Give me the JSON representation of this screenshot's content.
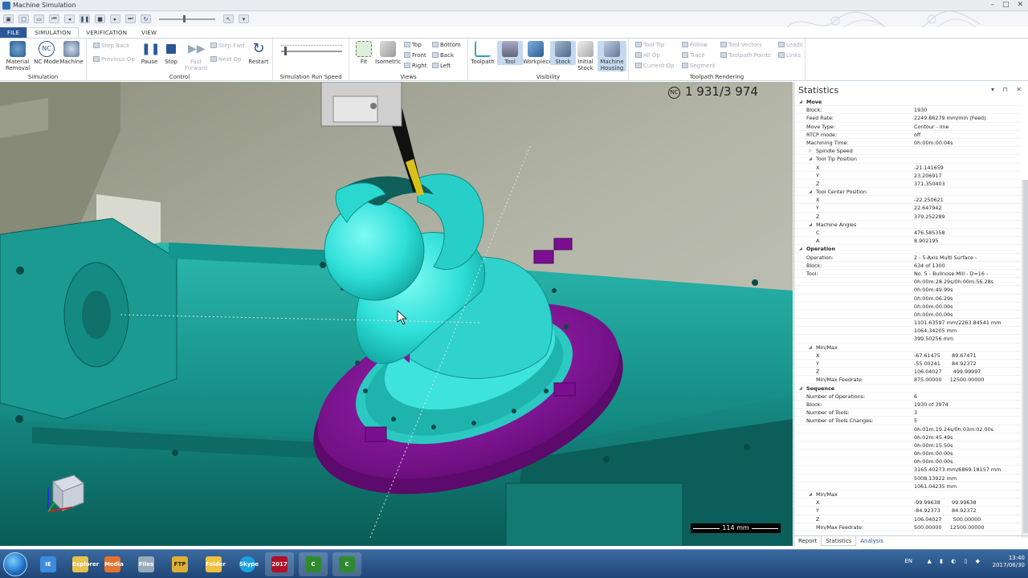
{
  "app": {
    "title": "Machine Simulation",
    "window_controls": [
      "–",
      "□",
      "✕"
    ]
  },
  "tabs": [
    "FILE",
    "SIMULATION",
    "VERIFICATION",
    "VIEW"
  ],
  "ribbon": {
    "simulation": {
      "label": "Simulation",
      "material_removal": "Material Removal",
      "nc_mode": "NC Mode",
      "machine": "Machine"
    },
    "control": {
      "label": "Control",
      "step_back": "Step Back",
      "previous_op": "Previous Op",
      "pause": "Pause",
      "stop": "Stop",
      "fast_forward": "Fast Forward",
      "step_fwd": "Step Fwd",
      "next_op": "Next Op",
      "restart": "Restart"
    },
    "run_speed": {
      "label": "Simulation Run Speed"
    },
    "views": {
      "label": "Views",
      "fit": "Fit",
      "isometric": "Isometric",
      "top": "Top",
      "front": "Front",
      "right": "Right",
      "bottom": "Bottom",
      "back": "Back",
      "left": "Left"
    },
    "visibility": {
      "label": "Visibility",
      "toolpath": "Toolpath",
      "tool": "Tool",
      "workpiece": "Workpiece",
      "stock": "Stock",
      "initial_stock": "Initial Stock",
      "machine_housing": "Machine Housing"
    },
    "toolpath_rendering": {
      "label": "Toolpath Rendering",
      "tool_tip": "Tool Tip",
      "all_op": "All Op",
      "current_op": "Current Op",
      "follow": "Follow",
      "trace": "Trace",
      "segment": "Segment",
      "tool_vectors": "Tool Vectors",
      "toolpath_points": "Toolpath Points",
      "leads": "Leads",
      "links": "Links"
    }
  },
  "viewport": {
    "nc_badge": "NC",
    "block_counter": "1 931/3 974",
    "scale": "114 mm"
  },
  "statistics": {
    "title": "Statistics",
    "controls": "▾ ⊓ ✕",
    "rows": [
      {
        "k": "Move",
        "v": "",
        "type": "sec"
      },
      {
        "k": "Block:",
        "v": "1930"
      },
      {
        "k": "Feed Rate:",
        "v": "2249.86279 mm/min (Feed)"
      },
      {
        "k": "Move Type:",
        "v": "Contour - line"
      },
      {
        "k": "RTCP mode:",
        "v": "off"
      },
      {
        "k": "Machining Time:",
        "v": "0h:00m:00.04s"
      },
      {
        "k": "Spindle Speed",
        "v": "",
        "type": "sub",
        "tw": "▷"
      },
      {
        "k": "Tool Tip Position",
        "v": "",
        "type": "sub"
      },
      {
        "k": "X",
        "v": "-21.141659",
        "type": "idx"
      },
      {
        "k": "Y",
        "v": "23.206917",
        "type": "idx"
      },
      {
        "k": "Z",
        "v": "371.350403",
        "type": "idx"
      },
      {
        "k": "Tool Center Position",
        "v": "",
        "type": "sub"
      },
      {
        "k": "X",
        "v": "-22.250621",
        "type": "idx"
      },
      {
        "k": "Y",
        "v": "22.647942",
        "type": "idx"
      },
      {
        "k": "Z",
        "v": "379.252289",
        "type": "idx"
      },
      {
        "k": "Machine Angles",
        "v": "",
        "type": "sub"
      },
      {
        "k": "C",
        "v": "476.585358",
        "type": "idx"
      },
      {
        "k": "A",
        "v": "8.902195",
        "type": "idx"
      },
      {
        "k": "Operation",
        "v": "",
        "type": "sec"
      },
      {
        "k": "Operation:",
        "v": "2 - 5-Axis Multi Surface -"
      },
      {
        "k": "Block:",
        "v": "634 of 1300"
      },
      {
        "k": "Tool:",
        "v": "No. 5 - Bullnose Mill - D=16 -"
      },
      {
        "k": "",
        "v": "0h:00m:28.29s/0h:00m:56.28s"
      },
      {
        "k": "",
        "v": "0h:00m:49.99s"
      },
      {
        "k": "",
        "v": "0h:00m:06.29s"
      },
      {
        "k": "",
        "v": "0h:00m:00.00s"
      },
      {
        "k": "",
        "v": "0h:00m:00.00s"
      },
      {
        "k": "",
        "v": "1101.63597 mm/2263.84541 mm"
      },
      {
        "k": "",
        "v": "1064.34205 mm"
      },
      {
        "k": "",
        "v": "399.50256 mm"
      },
      {
        "k": "Min/Max",
        "v": "",
        "type": "sub"
      },
      {
        "k": "X",
        "v": "-67.61475       89.67471",
        "type": "idx"
      },
      {
        "k": "Y",
        "v": "-55.00241       84.92372",
        "type": "idx"
      },
      {
        "k": "Z",
        "v": "106.04027       499.99997",
        "type": "idx"
      },
      {
        "k": "Min/Max Feedrate:",
        "v": "875.00000     12500.00000",
        "type": "idx"
      },
      {
        "k": "Sequence",
        "v": "",
        "type": "sec"
      },
      {
        "k": "Number of Operations:",
        "v": "6"
      },
      {
        "k": "Block:",
        "v": "1930 of 3974"
      },
      {
        "k": "Number of Tools:",
        "v": "3"
      },
      {
        "k": "Number of Tools Changes:",
        "v": "5"
      },
      {
        "k": "",
        "v": "0h:01m:19.24s/0h:03m:02.00s"
      },
      {
        "k": "",
        "v": "0h:02m:45.49s"
      },
      {
        "k": "",
        "v": "0h:00m:15.50s"
      },
      {
        "k": "",
        "v": "0h:00m:00.00s"
      },
      {
        "k": "",
        "v": "0h:00m:00.00s"
      },
      {
        "k": "",
        "v": "3165.40273 mm/6869.18157 mm"
      },
      {
        "k": "",
        "v": "5008.13922 mm"
      },
      {
        "k": "",
        "v": "1061.04235 mm"
      },
      {
        "k": "Min/Max",
        "v": "",
        "type": "sub"
      },
      {
        "k": "X",
        "v": "-99.99638       99.99638",
        "type": "idx"
      },
      {
        "k": "Y",
        "v": "-84.92373       84.92372",
        "type": "idx"
      },
      {
        "k": "Z",
        "v": "106.04027       500.00000",
        "type": "idx"
      },
      {
        "k": "Min/Max Feedrate:",
        "v": "500.00000     12500.00000",
        "type": "idx"
      }
    ],
    "tabs": [
      "Report",
      "Statistics",
      "Analysis"
    ]
  },
  "taskbar": {
    "apps": [
      "IE",
      "Explorer",
      "Media",
      "Files",
      "FTP",
      "Folder",
      "Skype",
      "2017",
      "C",
      "C"
    ],
    "lang": "EN",
    "time": "13:40",
    "date": "2017/06/30"
  },
  "colors": {
    "machine_teal": "#1aa39a",
    "part_cyan": "#2ee6e0",
    "fixture_purple": "#8a14a0",
    "background": "#a8ab9c",
    "file_tab": "#2b5797"
  }
}
